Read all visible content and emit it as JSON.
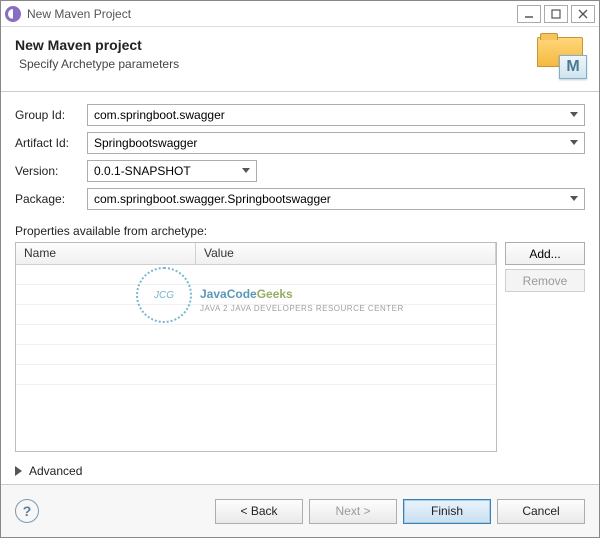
{
  "window": {
    "title": "New Maven Project"
  },
  "header": {
    "heading": "New Maven project",
    "subtitle": "Specify Archetype parameters",
    "icon_badge": "M"
  },
  "form": {
    "group_id": {
      "label": "Group Id:",
      "value": "com.springboot.swagger"
    },
    "artifact_id": {
      "label": "Artifact Id:",
      "value": "Springbootswagger"
    },
    "version": {
      "label": "Version:",
      "value": "0.0.1-SNAPSHOT"
    },
    "package": {
      "label": "Package:",
      "value": "com.springboot.swagger.Springbootswagger"
    }
  },
  "properties": {
    "section_label": "Properties available from archetype:",
    "columns": {
      "name": "Name",
      "value": "Value"
    },
    "rows": [],
    "buttons": {
      "add": "Add...",
      "remove": "Remove"
    }
  },
  "advanced": {
    "label": "Advanced"
  },
  "buttons": {
    "back": "< Back",
    "next": "Next >",
    "finish": "Finish",
    "cancel": "Cancel"
  },
  "watermark": {
    "circle": "JCG",
    "main1": "Java",
    "main2": "Code",
    "main3": "Geeks",
    "sub": "Java 2 Java Developers Resource Center"
  }
}
